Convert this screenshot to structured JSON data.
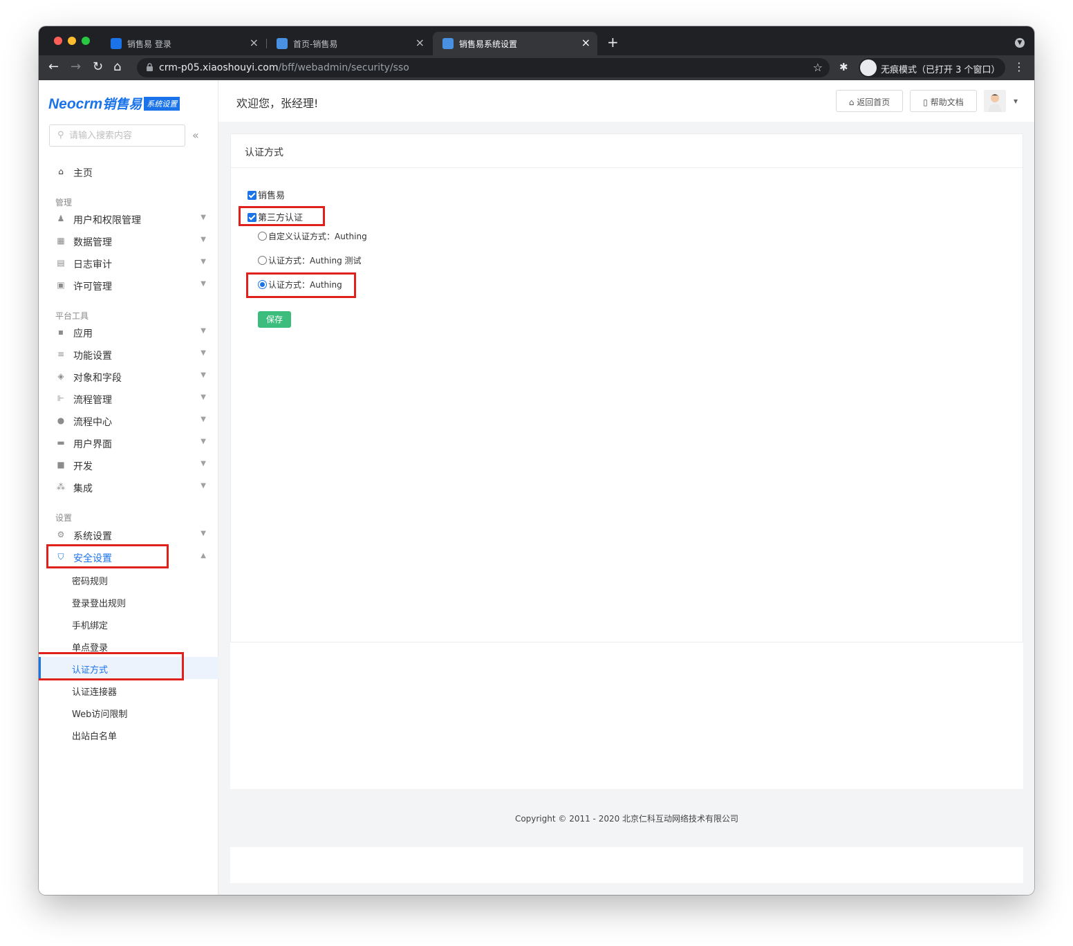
{
  "browser": {
    "tabs": [
      {
        "title": "销售易 登录",
        "favicon_color": "#1a73e8"
      },
      {
        "title": "首页-销售易",
        "favicon_color": "#4a90e2"
      },
      {
        "title": "销售易系统设置",
        "favicon_color": "#4a90e2"
      }
    ],
    "url_host": "crm-p05.xiaoshouyi.com",
    "url_path": "/bff/webadmin/security/sso",
    "incognito_label": "无痕模式（已打开 3 个窗口）"
  },
  "sidebar": {
    "logo_brand": "Neocrm",
    "logo_cn": "销售易",
    "logo_badge": "系统设置",
    "search_placeholder": "请输入搜索内容",
    "home_label": "主页",
    "groups": {
      "manage": "管理",
      "platform": "平台工具",
      "settings": "设置"
    },
    "manage_items": [
      "用户和权限管理",
      "数据管理",
      "日志审计",
      "许可管理"
    ],
    "platform_items": [
      "应用",
      "功能设置",
      "对象和字段",
      "流程管理",
      "流程中心",
      "用户界面",
      "开发",
      "集成"
    ],
    "settings_items": [
      "系统设置",
      "安全设置"
    ],
    "security_sub_items": [
      "密码规则",
      "登录登出规则",
      "手机绑定",
      "单点登录",
      "认证方式",
      "认证连接器",
      "Web访问限制",
      "出站白名单"
    ]
  },
  "header": {
    "welcome": "欢迎您，张经理!",
    "home_button": "返回首页",
    "help_button": "帮助文档"
  },
  "panel": {
    "title": "认证方式",
    "checkbox_xsy": "销售易",
    "checkbox_third": "第三方认证",
    "radio_options": [
      "自定义认证方式：Authing",
      "认证方式：Authing 测试",
      "认证方式：Authing"
    ],
    "selected_radio": 2,
    "save_label": "保存"
  },
  "footer": {
    "copyright": "Copyright © 2011 - 2020 北京仁科互动网络技术有限公司"
  },
  "colors": {
    "accent": "#1a73e8",
    "save_button": "#3dbd7d",
    "highlight_box": "#e0201a"
  }
}
